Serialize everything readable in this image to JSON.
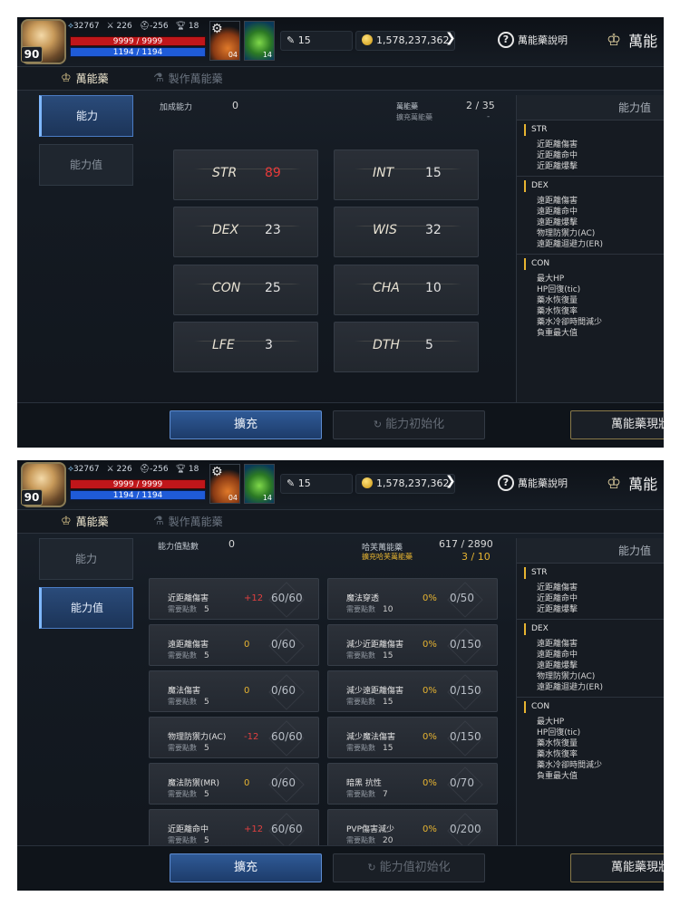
{
  "topbar": {
    "level": "90",
    "power": "32767",
    "attack": "226",
    "defense": "-256",
    "trophy": "18",
    "hp": "9999 / 9999",
    "mp": "1194 / 1194",
    "slot1_count": "04",
    "slot2_count": "14",
    "gems": "15",
    "gold": "1,578,237,362",
    "help_label": "萬能藥說明",
    "brand_text": "萬能"
  },
  "tabs": {
    "main": "萬能藥",
    "craft": "製作萬能藥"
  },
  "sidebar": {
    "ability": "能力",
    "ability_value": "能力值"
  },
  "screen1": {
    "bonus_label": "加成能力",
    "bonus_value": "0",
    "elixir_label": "萬能藥",
    "elixir_sub": "擴充萬能藥",
    "elixir_value": "2 / 35",
    "elixir_sub_value": "-",
    "stats": [
      {
        "name": "STR",
        "value": "89",
        "highlight": true
      },
      {
        "name": "INT",
        "value": "15",
        "highlight": false
      },
      {
        "name": "DEX",
        "value": "23",
        "highlight": false
      },
      {
        "name": "WIS",
        "value": "32",
        "highlight": false
      },
      {
        "name": "CON",
        "value": "25",
        "highlight": false
      },
      {
        "name": "CHA",
        "value": "10",
        "highlight": false
      },
      {
        "name": "LFE",
        "value": "3",
        "highlight": false
      },
      {
        "name": "DTH",
        "value": "5",
        "highlight": false
      }
    ],
    "btn_expand": "擴充",
    "btn_reset": "能力初始化",
    "btn_cash": "萬能藥現狀"
  },
  "screen2": {
    "points_label": "能力值點數",
    "points_value": "0",
    "elixir_label": "哈芙萬能藥",
    "elixir_sub": "擴充哈芙萬能藥",
    "elixir_value": "617 / 2890",
    "elixir_sub_value": "3 / 10",
    "req_label": "需要點數",
    "rows_left": [
      {
        "name": "近距離傷害",
        "req": "5",
        "bonus": "+12",
        "bonus_color": "r",
        "value": "60/60"
      },
      {
        "name": "遠距離傷害",
        "req": "5",
        "bonus": "0",
        "bonus_color": "o",
        "value": "0/60"
      },
      {
        "name": "魔法傷害",
        "req": "5",
        "bonus": "0",
        "bonus_color": "o",
        "value": "0/60"
      },
      {
        "name": "物理防禦力(AC)",
        "req": "5",
        "bonus": "-12",
        "bonus_color": "r",
        "value": "60/60"
      },
      {
        "name": "魔法防禦(MR)",
        "req": "5",
        "bonus": "0",
        "bonus_color": "o",
        "value": "0/60"
      },
      {
        "name": "近距離命中",
        "req": "5",
        "bonus": "+12",
        "bonus_color": "r",
        "value": "60/60"
      }
    ],
    "rows_right": [
      {
        "name": "魔法穿透",
        "req": "10",
        "bonus": "0%",
        "bonus_color": "o",
        "value": "0/50"
      },
      {
        "name": "減少近距離傷害",
        "req": "15",
        "bonus": "0%",
        "bonus_color": "o",
        "value": "0/150"
      },
      {
        "name": "減少遠距離傷害",
        "req": "15",
        "bonus": "0%",
        "bonus_color": "o",
        "value": "0/150"
      },
      {
        "name": "減少魔法傷害",
        "req": "15",
        "bonus": "0%",
        "bonus_color": "o",
        "value": "0/150"
      },
      {
        "name": "暗黑 抗性",
        "req": "7",
        "bonus": "0%",
        "bonus_color": "o",
        "value": "0/70"
      },
      {
        "name": "PVP傷害減少",
        "req": "20",
        "bonus": "0%",
        "bonus_color": "o",
        "value": "0/200"
      }
    ],
    "btn_expand": "擴充",
    "btn_reset": "能力值初始化",
    "btn_cash": "萬能藥現狀"
  },
  "rightpanel": {
    "title": "能力值",
    "groups": [
      {
        "name": "STR",
        "items": [
          "近距離傷害",
          "近距離命中",
          "近距離爆擊"
        ]
      },
      {
        "name": "DEX",
        "items": [
          "遠距離傷害",
          "遠距離命中",
          "遠距離爆擊",
          "物理防禦力(AC)",
          "遠距離迴避力(ER)"
        ]
      },
      {
        "name": "CON",
        "items": [
          "最大HP",
          "HP回復(tic)",
          "藥水恢復量",
          "藥水恢復率",
          "藥水冷卻時間減少",
          "負重最大值"
        ]
      }
    ]
  },
  "colors": {
    "accent_blue": "#4b7cc4",
    "gold": "#e7b431",
    "red": "#e83a3a"
  }
}
